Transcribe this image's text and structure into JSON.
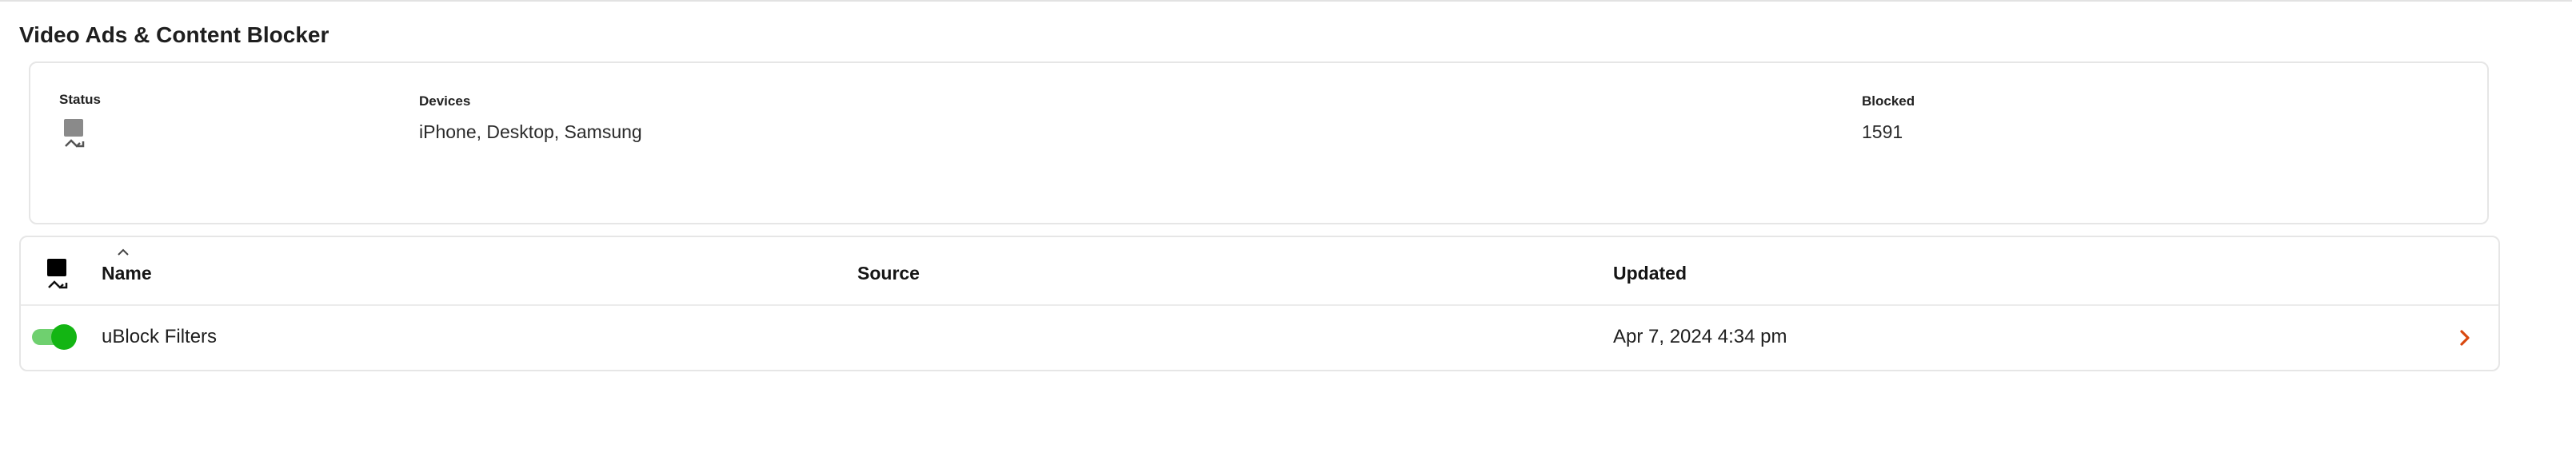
{
  "page": {
    "title": "Video Ads & Content Blocker"
  },
  "summary": {
    "status_label": "Status",
    "status_icon": "broken-image-icon",
    "devices_label": "Devices",
    "devices_value": "iPhone, Desktop, Samsung",
    "blocked_label": "Blocked",
    "blocked_value": "1591"
  },
  "table": {
    "header_icon": "broken-image-icon",
    "sort_column": "Name",
    "sort_direction": "ascending",
    "columns": {
      "name": "Name",
      "source": "Source",
      "updated": "Updated"
    },
    "rows": [
      {
        "enabled": true,
        "name": "uBlock Filters",
        "source": "",
        "updated": "Apr 7, 2024 4:34 pm"
      }
    ]
  },
  "colors": {
    "toggle_on_track": "#6fd06f",
    "toggle_on_knob": "#13b513",
    "chevron": "#d9480f",
    "border": "#e6e6e6"
  }
}
